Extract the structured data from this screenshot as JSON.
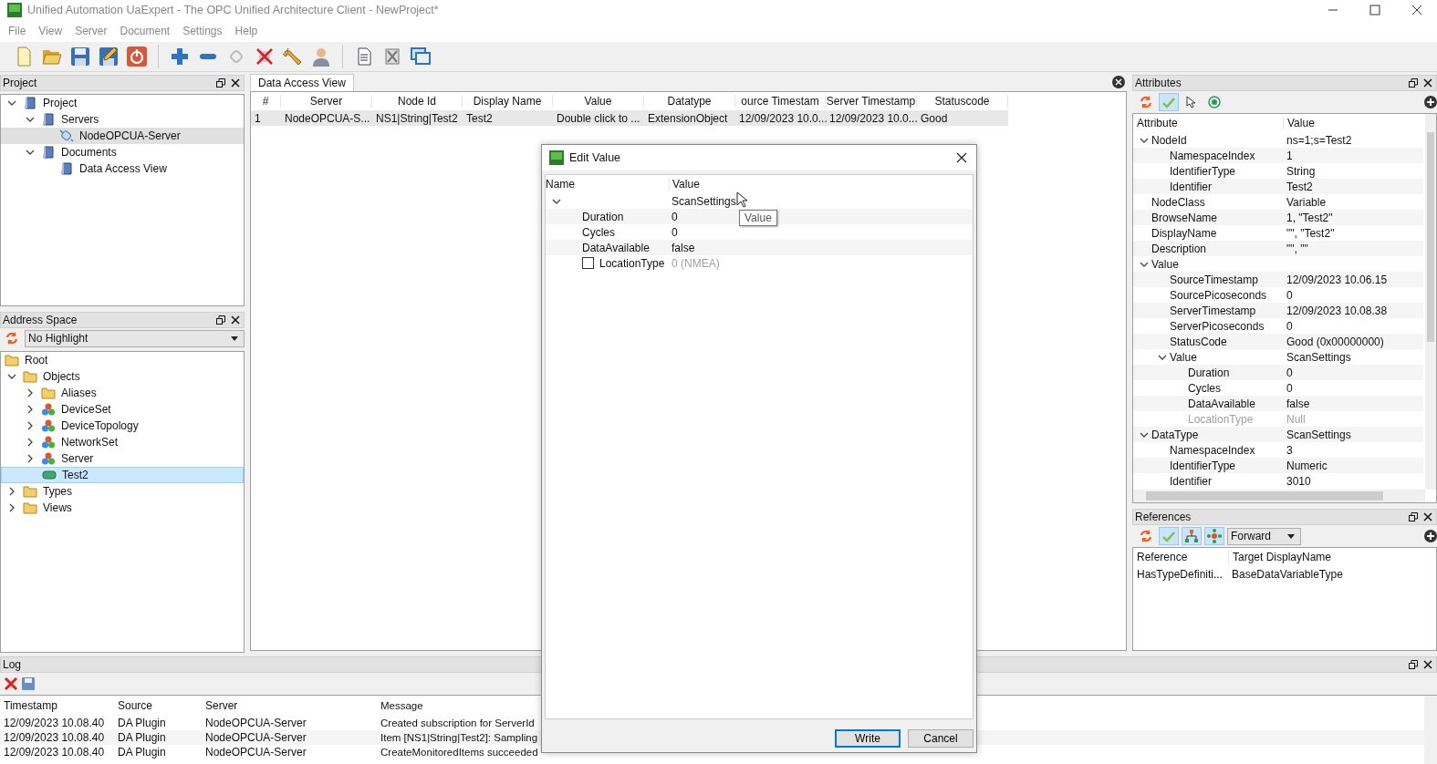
{
  "window": {
    "title": "Unified Automation UaExpert - The OPC Unified Architecture Client - NewProject*"
  },
  "menu": [
    "File",
    "View",
    "Server",
    "Document",
    "Settings",
    "Help"
  ],
  "project_panel": {
    "title": "Project",
    "tree": [
      {
        "label": "Project",
        "kind": "book",
        "expanded": true,
        "selected": false,
        "children": [
          {
            "label": "Servers",
            "kind": "book",
            "expanded": true,
            "selected": false,
            "children": [
              {
                "label": "NodeOPCUA-Server",
                "kind": "server",
                "selected": true
              }
            ]
          },
          {
            "label": "Documents",
            "kind": "book",
            "expanded": true,
            "selected": false,
            "children": [
              {
                "label": "Data Access View",
                "kind": "book",
                "selected": false
              }
            ]
          }
        ]
      }
    ]
  },
  "address_space": {
    "title": "Address Space",
    "highlight": "No Highlight",
    "tree": [
      {
        "label": "Root",
        "kind": "folder",
        "selected": false,
        "children": [
          {
            "label": "Objects",
            "kind": "folder",
            "expanded": true,
            "selected": false,
            "children": [
              {
                "label": "Aliases",
                "kind": "folder",
                "expanded": false,
                "selected": false
              },
              {
                "label": "DeviceSet",
                "kind": "object",
                "expanded": false,
                "selected": false
              },
              {
                "label": "DeviceTopology",
                "kind": "object",
                "expanded": false,
                "selected": false
              },
              {
                "label": "NetworkSet",
                "kind": "object",
                "expanded": false,
                "selected": false
              },
              {
                "label": "Server",
                "kind": "object",
                "expanded": false,
                "selected": false
              },
              {
                "label": "Test2",
                "kind": "variable",
                "selected": true
              }
            ]
          },
          {
            "label": "Types",
            "kind": "folder",
            "expanded": false,
            "selected": false
          },
          {
            "label": "Views",
            "kind": "folder",
            "expanded": false,
            "selected": false
          }
        ]
      }
    ]
  },
  "tabs": [
    {
      "label": "Data Access View",
      "selected": true
    }
  ],
  "data_access": {
    "columns": [
      "#",
      "Server",
      "Node Id",
      "Display Name",
      "Value",
      "Datatype",
      "ource Timestam",
      "Server Timestamp",
      "Statuscode"
    ],
    "rows": [
      {
        "cells": [
          "1",
          "NodeOPCUA-S...",
          "NS1|String|Test2",
          "Test2",
          "Double click to ...",
          "ExtensionObject",
          "12/09/2023 10.0...",
          "12/09/2023 10.0...",
          "Good"
        ],
        "selected": true
      }
    ]
  },
  "dialog": {
    "title": "Edit Value",
    "columns": [
      "Name",
      "Value"
    ],
    "tree": [
      {
        "value": "ScanSettings",
        "expanded": true,
        "children": [
          {
            "name": "Duration",
            "value": "0",
            "kind": "text"
          },
          {
            "name": "Cycles",
            "value": "0",
            "kind": "text"
          },
          {
            "name": "DataAvailable",
            "value": "false",
            "kind": "text"
          },
          {
            "name": "LocationType",
            "value": "0 (NMEA)",
            "kind": "checkbox",
            "checked": false,
            "disabled": true
          }
        ]
      }
    ],
    "tooltip": "Value",
    "buttons": [
      {
        "label": "Write",
        "default": true
      },
      {
        "label": "Cancel",
        "default": false
      }
    ]
  },
  "attributes": {
    "title": "Attributes",
    "toolbar": [
      {
        "kind": "refresh",
        "on": false
      },
      {
        "kind": "check",
        "on": true
      },
      {
        "kind": "pointer",
        "on": false
      },
      {
        "kind": "target",
        "on": false
      }
    ],
    "columns": [
      "Attribute",
      "Value"
    ],
    "tree": [
      {
        "name": "NodeId",
        "value": "ns=1;s=Test2",
        "expanded": true,
        "children": [
          {
            "name": "NamespaceIndex",
            "value": "1"
          },
          {
            "name": "IdentifierType",
            "value": "String"
          },
          {
            "name": "Identifier",
            "value": "Test2"
          }
        ]
      },
      {
        "name": "NodeClass",
        "value": "Variable"
      },
      {
        "name": "BrowseName",
        "value": "1, \"Test2\""
      },
      {
        "name": "DisplayName",
        "value": "\"\", \"Test2\""
      },
      {
        "name": "Description",
        "value": "\"\", \"\""
      },
      {
        "name": "Value",
        "expanded": true,
        "children": [
          {
            "name": "SourceTimestamp",
            "value": "12/09/2023 10.06.15"
          },
          {
            "name": "SourcePicoseconds",
            "value": "0"
          },
          {
            "name": "ServerTimestamp",
            "value": "12/09/2023 10.08.38"
          },
          {
            "name": "ServerPicoseconds",
            "value": "0"
          },
          {
            "name": "StatusCode",
            "value": "Good (0x00000000)"
          },
          {
            "name": "Value",
            "value": "ScanSettings",
            "expanded": true,
            "children": [
              {
                "name": "Duration",
                "value": "0",
                "disabled": false
              },
              {
                "name": "Cycles",
                "value": "0",
                "disabled": false
              },
              {
                "name": "DataAvailable",
                "value": "false",
                "disabled": false
              },
              {
                "name": "LocationType",
                "value": "Null",
                "disabled": true
              }
            ]
          }
        ]
      },
      {
        "name": "DataType",
        "value": "ScanSettings",
        "expanded": true,
        "children": [
          {
            "name": "NamespaceIndex",
            "value": "3"
          },
          {
            "name": "IdentifierType",
            "value": "Numeric"
          },
          {
            "name": "Identifier",
            "value": "3010"
          }
        ]
      }
    ]
  },
  "references": {
    "title": "References",
    "toolbar": [
      {
        "kind": "refresh",
        "on": false
      },
      {
        "kind": "check",
        "on": true
      },
      {
        "kind": "hierarchy",
        "on": true
      },
      {
        "kind": "network",
        "on": true
      }
    ],
    "direction": "Forward",
    "columns": [
      "Reference",
      "Target DisplayName"
    ],
    "rows": [
      [
        "HasTypeDefiniti...",
        "BaseDataVariableType"
      ]
    ]
  },
  "log": {
    "title": "Log",
    "columns": [
      "Timestamp",
      "Source",
      "Server",
      "Message"
    ],
    "rows": [
      [
        "12/09/2023 10.08.40",
        "DA Plugin",
        "NodeOPCUA-Server",
        "Created subscription for ServerId"
      ],
      [
        "12/09/2023 10.08.40",
        "DA Plugin",
        "NodeOPCUA-Server",
        "Item [NS1|String|Test2]: Sampling"
      ],
      [
        "12/09/2023 10.08.40",
        "DA Plugin",
        "NodeOPCUA-Server",
        "CreateMonitoredItems succeeded"
      ]
    ]
  }
}
